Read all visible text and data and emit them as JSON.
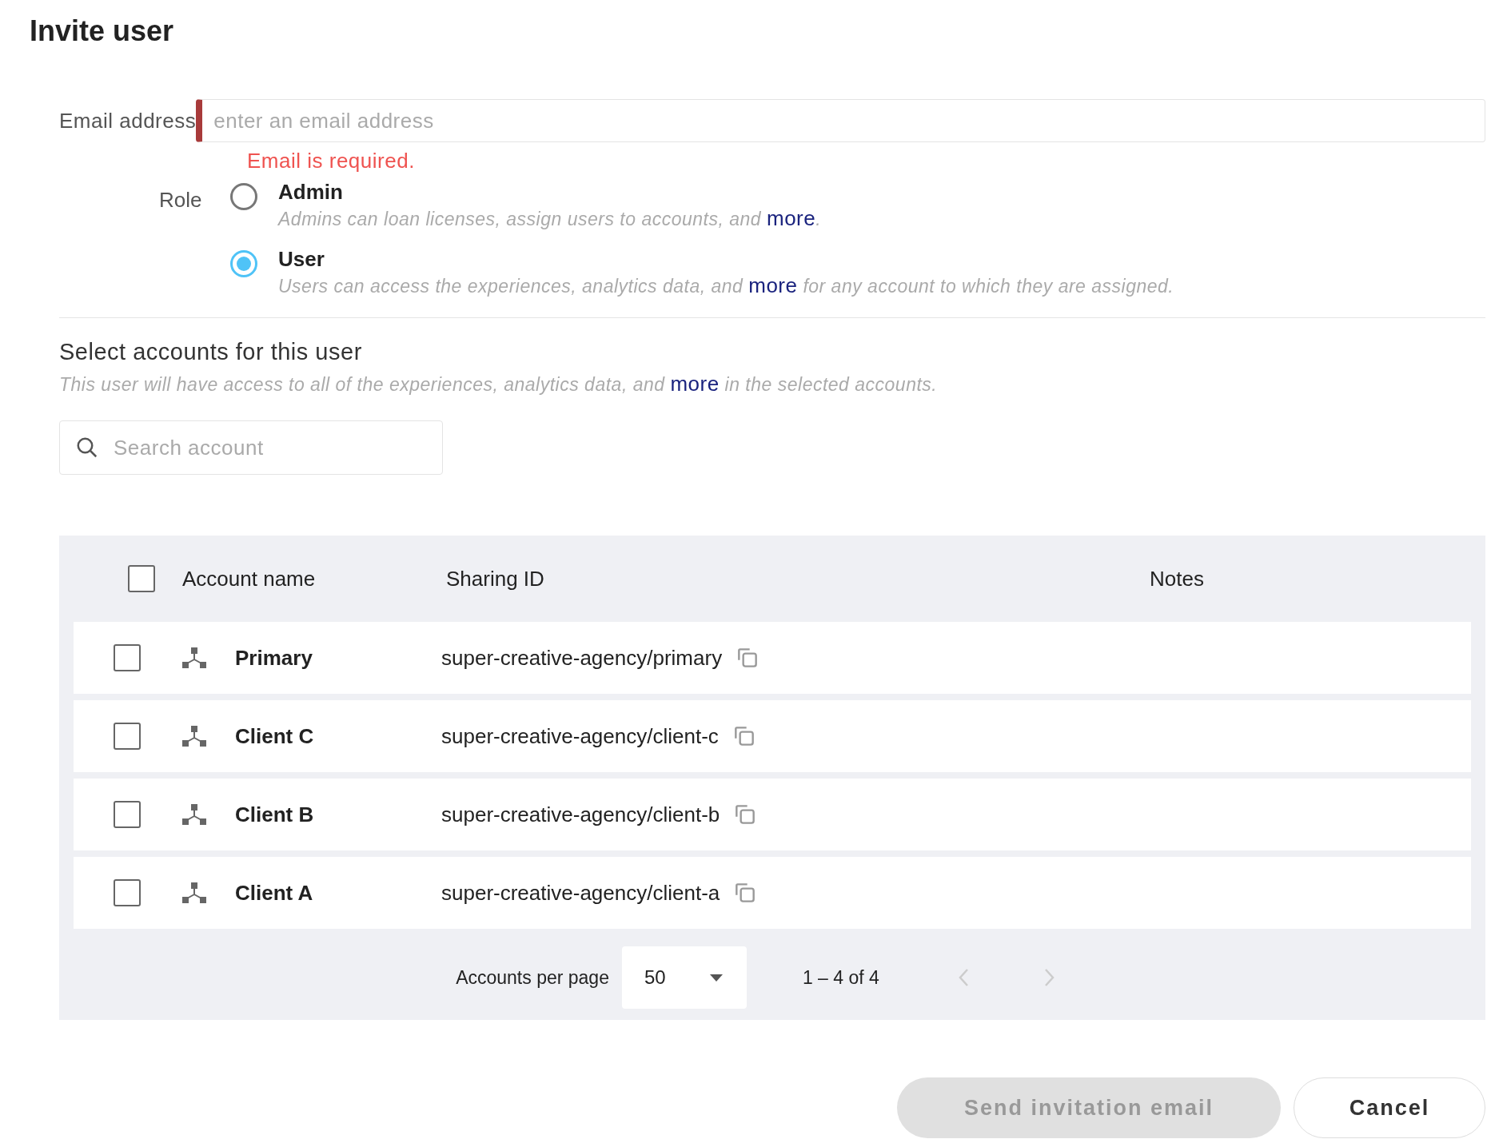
{
  "title": "Invite user",
  "email": {
    "label": "Email address",
    "placeholder": "enter an email address",
    "error": "Email is required.",
    "invalid": true
  },
  "role": {
    "label": "Role",
    "options": [
      {
        "label": "Admin",
        "selected": false,
        "description": {
          "before": "Admins can loan licenses, assign users to accounts, and ",
          "link": "more",
          "after": "."
        }
      },
      {
        "label": "User",
        "selected": true,
        "description": {
          "before": "Users can access the experiences, analytics data, and ",
          "link": "more",
          "after": " for any account to which they are assigned."
        }
      }
    ]
  },
  "accounts_section": {
    "title": "Select accounts for this user",
    "description": {
      "before": "This user will have access to all of the experiences, analytics data, and ",
      "link": "more",
      "after": " in the selected accounts."
    }
  },
  "search": {
    "placeholder": "Search account"
  },
  "table": {
    "select_all_checked": false,
    "columns": [
      "Account name",
      "Sharing ID",
      "Notes"
    ],
    "rows": [
      {
        "checked": false,
        "name": "Primary",
        "sharing_id": "super-creative-agency/primary"
      },
      {
        "checked": false,
        "name": "Client C",
        "sharing_id": "super-creative-agency/client-c"
      },
      {
        "checked": false,
        "name": "Client B",
        "sharing_id": "super-creative-agency/client-b"
      },
      {
        "checked": false,
        "name": "Client A",
        "sharing_id": "super-creative-agency/client-a"
      }
    ]
  },
  "pagination": {
    "label": "Accounts per page",
    "per_page": "50",
    "range": "1 – 4 of 4",
    "prev_disabled": true,
    "next_disabled": true
  },
  "buttons": [
    {
      "label": "Send invitation email",
      "kind": "primary",
      "disabled": true
    },
    {
      "label": "Cancel",
      "kind": "secondary",
      "disabled": false
    }
  ]
}
